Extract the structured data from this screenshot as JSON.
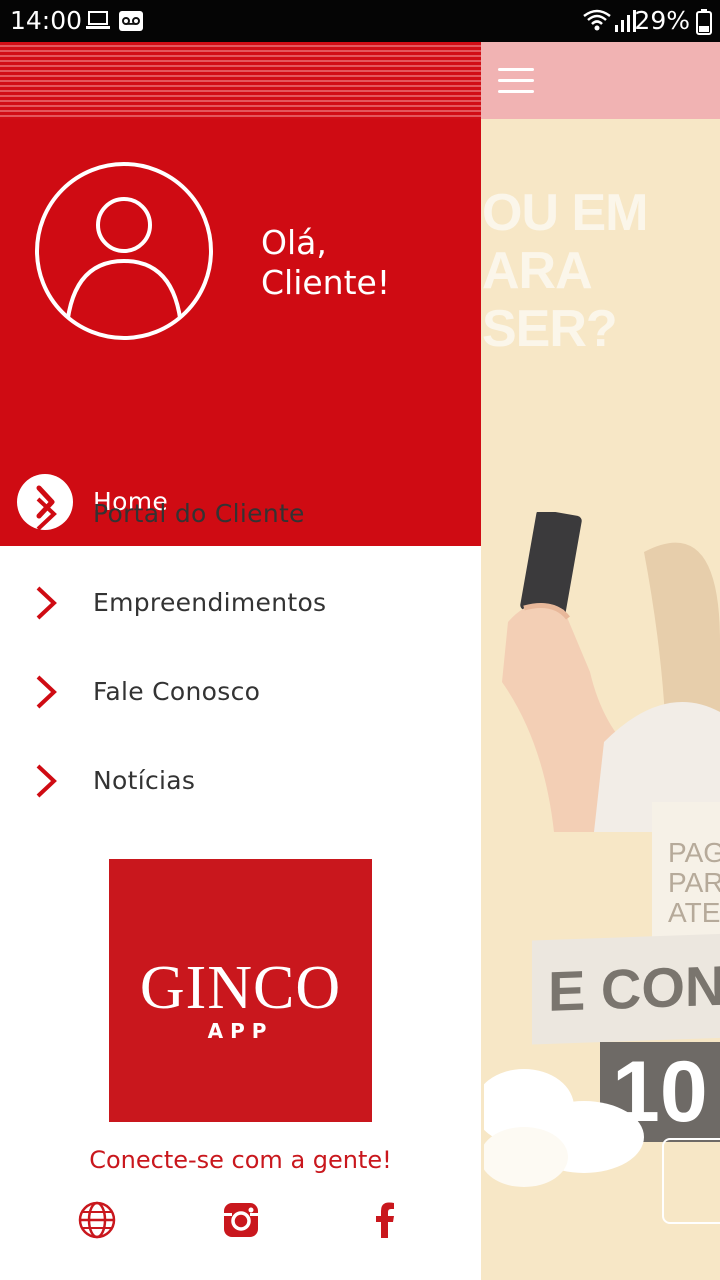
{
  "status_bar": {
    "time": "14:00",
    "battery": "29%",
    "icons": [
      "laptop-icon",
      "voicemail-icon",
      "wifi-icon",
      "signal-icon",
      "battery-icon"
    ]
  },
  "background_app": {
    "menu_icon": "hamburger-icon",
    "promo_headline": "OU EM\nARA\nSER?",
    "promo_sign": "PAG\nPAR\nATE",
    "promo_banner": "E CONCORR",
    "promo_counter": "10"
  },
  "drawer": {
    "greeting": "Olá, Cliente!",
    "avatar_icon": "user-avatar-icon",
    "menu": [
      {
        "label": "Home",
        "active": true
      },
      {
        "label": "Portal do Cliente",
        "active": false
      },
      {
        "label": "Empreendimentos",
        "active": false
      },
      {
        "label": "Fale Conosco",
        "active": false
      },
      {
        "label": "Notícias",
        "active": false
      }
    ],
    "logo": {
      "word": "GINCO",
      "sub": "APP"
    },
    "connect_text": "Conecte-se com a gente!",
    "social": [
      "globe-icon",
      "instagram-icon",
      "facebook-icon"
    ]
  },
  "colors": {
    "brand_red": "#cf0b13",
    "logo_red": "#c9171d",
    "toolbar_pink": "#f1b3b3"
  }
}
